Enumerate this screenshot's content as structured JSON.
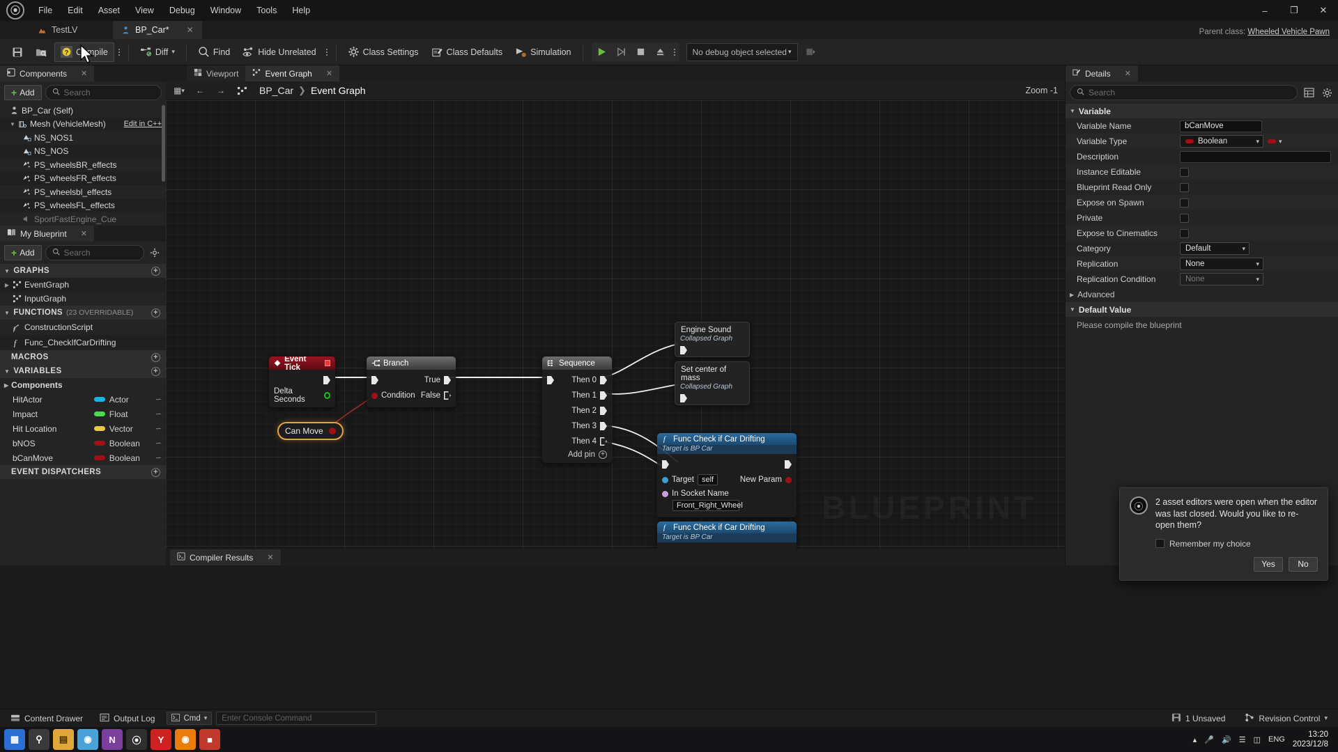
{
  "menu": {
    "items": [
      "File",
      "Edit",
      "Asset",
      "View",
      "Debug",
      "Window",
      "Tools",
      "Help"
    ],
    "logo": "ue-logo-icon"
  },
  "window_controls": {
    "minimize": "–",
    "maximize": "❐",
    "close": "✕"
  },
  "tabs": [
    {
      "label": "TestLV",
      "icon": "level-icon",
      "active": false,
      "close": ""
    },
    {
      "label": "BP_Car*",
      "icon": "blueprint-icon",
      "active": true,
      "close": "✕"
    }
  ],
  "parent_class": {
    "label": "Parent class:",
    "value": "Wheeled Vehicle Pawn"
  },
  "toolbar": {
    "save_icon": "save-icon",
    "browse_icon": "browse-content-icon",
    "compile_label": "Compile",
    "compile_icon": "compile-question-icon",
    "diff_label": "Diff",
    "find_label": "Find",
    "hide_unrelated_label": "Hide Unrelated",
    "class_settings_label": "Class Settings",
    "class_defaults_label": "Class Defaults",
    "simulation_label": "Simulation",
    "play_icon": "play-icon",
    "step_icon": "step-icon",
    "stop_icon": "stop-icon",
    "eject_icon": "eject-icon",
    "debug_object": "No debug object selected"
  },
  "components_panel": {
    "tab_label": "Components",
    "tab_icon": "components-icon",
    "add_label": "Add",
    "search_placeholder": "Search",
    "items": [
      {
        "label": "BP_Car (Self)",
        "icon": "pawn-icon",
        "indent": 0,
        "arrow": ""
      },
      {
        "label": "Mesh (VehicleMesh)",
        "icon": "skeletal-mesh-icon",
        "indent": 1,
        "arrow": "▼",
        "action": "Edit in C++"
      },
      {
        "label": "NS_NOS1",
        "icon": "niagara-icon",
        "indent": 2,
        "arrow": ""
      },
      {
        "label": "NS_NOS",
        "icon": "niagara-icon",
        "indent": 2,
        "arrow": ""
      },
      {
        "label": "PS_wheelsBR_effects",
        "icon": "particle-icon",
        "indent": 2,
        "arrow": ""
      },
      {
        "label": "PS_wheelsFR_effects",
        "icon": "particle-icon",
        "indent": 2,
        "arrow": ""
      },
      {
        "label": "PS_wheelsbl_effects",
        "icon": "particle-icon",
        "indent": 2,
        "arrow": ""
      },
      {
        "label": "PS_wheelsFL_effects",
        "icon": "particle-icon",
        "indent": 2,
        "arrow": ""
      },
      {
        "label": "SportFastEngine_Cue",
        "icon": "audio-icon",
        "indent": 2,
        "arrow": ""
      }
    ]
  },
  "myblueprint_panel": {
    "tab_label": "My Blueprint",
    "tab_icon": "book-icon",
    "add_label": "Add",
    "search_placeholder": "Search",
    "graphs_header": "GRAPHS",
    "graphs": [
      {
        "label": "EventGraph",
        "icon": "graph-icon",
        "arrow": "▶"
      },
      {
        "label": "InputGraph",
        "icon": "graph-icon",
        "arrow": ""
      }
    ],
    "functions_header": "FUNCTIONS",
    "functions_sub": "(23 OVERRIDABLE)",
    "functions": [
      {
        "label": "ConstructionScript",
        "icon": "construction-script-icon"
      },
      {
        "label": "Func_CheckIfCarDrifting",
        "icon": "function-icon"
      }
    ],
    "macros_header": "MACROS",
    "variables_header": "VARIABLES",
    "components_subheader": "Components",
    "variables": [
      {
        "name": "HitActor",
        "type": "Actor",
        "color": "#19b4e6"
      },
      {
        "name": "Impact",
        "type": "Float",
        "color": "#4ed84e"
      },
      {
        "name": "Hit Location",
        "type": "Vector",
        "color": "#e7c84a"
      },
      {
        "name": "bNOS",
        "type": "Boolean",
        "color": "#a30f14"
      },
      {
        "name": "bCanMove",
        "type": "Boolean",
        "color": "#a30f14"
      }
    ],
    "dispatchers_header": "EVENT DISPATCHERS"
  },
  "graph_panel": {
    "tabs": [
      {
        "label": "Viewport",
        "icon": "viewport-icon",
        "active": false,
        "close": ""
      },
      {
        "label": "Event Graph",
        "icon": "event-graph-icon",
        "active": true,
        "close": "✕"
      }
    ],
    "back_icon": "back-arrow-icon",
    "forward_icon": "forward-arrow-icon",
    "home_icon": "graph-home-icon",
    "breadcrumb_root": "BP_Car",
    "breadcrumb_sep": "❯",
    "breadcrumb_leaf": "Event Graph",
    "zoom_label": "Zoom -1",
    "watermark": "BLUEPRINT"
  },
  "nodes": {
    "event_tick": {
      "title": "Event Tick",
      "pin_out": "Delta Seconds"
    },
    "branch": {
      "title": "Branch",
      "true_label": "True",
      "false_label": "False",
      "condition_label": "Condition"
    },
    "sequence": {
      "title": "Sequence",
      "pins": [
        "Then 0",
        "Then 1",
        "Then 2",
        "Then 3",
        "Then 4"
      ],
      "add_pin": "Add pin"
    },
    "can_move": {
      "label": "Can Move"
    },
    "engine_sound": {
      "title": "Engine Sound",
      "subtitle": "Collapsed Graph"
    },
    "set_center_mass": {
      "title": "Set center of mass",
      "subtitle": "Collapsed Graph"
    },
    "func_drift_1": {
      "title": "Func Check if Car Drifting",
      "subtitle": "Target is BP Car",
      "target_label": "Target",
      "target_value": "self",
      "socket_label": "In Socket Name",
      "socket_value": "Front_Right_Wheel",
      "new_param_label": "New Param"
    },
    "func_drift_2": {
      "title": "Func Check if Car Drifting",
      "subtitle": "Target is BP Car"
    }
  },
  "compiler_results": {
    "label": "Compiler Results",
    "icon": "compiler-icon",
    "close": "✕"
  },
  "details_panel": {
    "tab_label": "Details",
    "tab_icon": "details-icon",
    "close": "✕",
    "search_placeholder": "Search",
    "grid_icon": "grid-view-icon",
    "settings_icon": "gear-icon",
    "variable_category": "Variable",
    "rows": [
      {
        "label": "Variable Name",
        "kind": "text",
        "value": "bCanMove"
      },
      {
        "label": "Variable Type",
        "kind": "type",
        "value": "Boolean",
        "color": "#a30f14"
      },
      {
        "label": "Description",
        "kind": "textwide",
        "value": ""
      },
      {
        "label": "Instance Editable",
        "kind": "check",
        "value": false
      },
      {
        "label": "Blueprint Read Only",
        "kind": "check",
        "value": false
      },
      {
        "label": "Expose on Spawn",
        "kind": "check",
        "value": false
      },
      {
        "label": "Private",
        "kind": "check",
        "value": false
      },
      {
        "label": "Expose to Cinematics",
        "kind": "check",
        "value": false
      },
      {
        "label": "Category",
        "kind": "select",
        "value": "Default"
      },
      {
        "label": "Replication",
        "kind": "select",
        "value": "None"
      },
      {
        "label": "Replication Condition",
        "kind": "select-dim",
        "value": "None"
      }
    ],
    "advanced_label": "Advanced",
    "default_value_header": "Default Value",
    "default_value_text": "Please compile the blueprint"
  },
  "notification": {
    "icon": "ue-logo-icon",
    "message": "2 asset editors were open when the editor was last closed. Would you like to re-open them?",
    "remember_label": "Remember my choice",
    "yes_label": "Yes",
    "no_label": "No"
  },
  "status_bar": {
    "content_drawer": "Content Drawer",
    "content_drawer_icon": "drawer-icon",
    "output_log": "Output Log",
    "output_log_icon": "log-icon",
    "cmd_label": "Cmd",
    "cmd_placeholder": "Enter Console Command",
    "unsaved": "1 Unsaved",
    "unsaved_icon": "save-icon",
    "revision_control": "Revision Control",
    "revision_icon": "revision-icon"
  },
  "taskbar": {
    "apps": [
      {
        "name": "start-icon",
        "glyph": "⊞",
        "color": "#2b6fd4"
      },
      {
        "name": "search-icon",
        "glyph": "⌕",
        "color": "#3a3a3a"
      },
      {
        "name": "explorer-icon",
        "glyph": "▤",
        "color": "#e0a83a"
      },
      {
        "name": "photos-icon",
        "glyph": "◰",
        "color": "#4aa3d8"
      },
      {
        "name": "onenote-icon",
        "glyph": "N",
        "color": "#7b3f9d"
      },
      {
        "name": "unreal-icon",
        "glyph": "ⓤ",
        "color": "#2f2f2f"
      },
      {
        "name": "youtube-icon",
        "glyph": "Y",
        "color": "#cc2222"
      },
      {
        "name": "blender-icon",
        "glyph": "◉",
        "color": "#e87d0d"
      },
      {
        "name": "browser-icon",
        "glyph": "■",
        "color": "#c0392b"
      }
    ],
    "tray_icons": [
      "up-chevron-icon",
      "mic-icon",
      "volume-icon",
      "wifi-icon",
      "battery-icon"
    ],
    "language": "ENG",
    "time": "13:20",
    "date": "2023/12/8"
  }
}
